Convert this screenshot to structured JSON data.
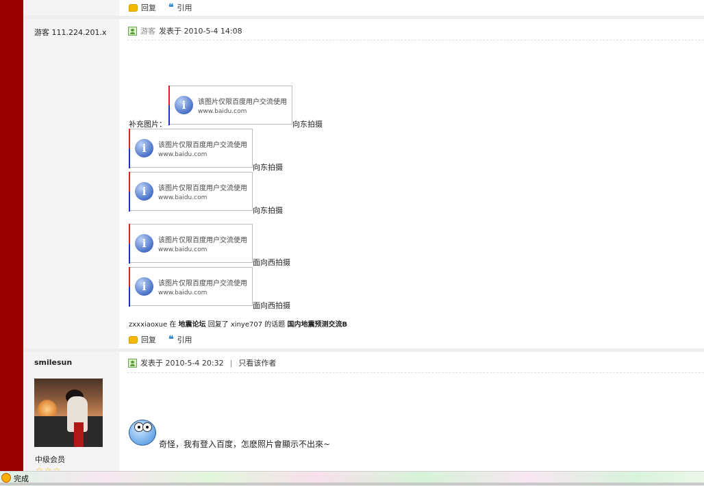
{
  "post_top": {
    "actions": {
      "reply": "回复",
      "quote": "引用"
    }
  },
  "post1": {
    "author": "游客 111.224.201.x",
    "meta": {
      "guest_label": "游客",
      "posted_text": "发表于 2010-5-4 14:08"
    },
    "supplement_label": "补充图片：",
    "image_placeholders": [
      {
        "line1": "该图片仅限百度用户交流使用",
        "line2": "www.baidu.com",
        "caption": "向东拍摄"
      },
      {
        "line1": "该图片仅限百度用户交流使用",
        "line2": "www.baidu.com",
        "caption": "向东拍摄"
      },
      {
        "line1": "该图片仅限百度用户交流使用",
        "line2": "www.baidu.com",
        "caption": "向东拍摄"
      },
      {
        "line1": "该图片仅限百度用户交流使用",
        "line2": "www.baidu.com",
        "caption": "面向西拍摄"
      },
      {
        "line1": "该图片仅限百度用户交流使用",
        "line2": "www.baidu.com",
        "caption": "面向西拍摄"
      }
    ],
    "activity": {
      "user": "zxxxiaoxue",
      "in_word": "在",
      "forum": "地震论坛",
      "replied": "回复了",
      "target_user": "xinye707",
      "topic_word": "的话题",
      "topic": "国内地震预测交流B"
    },
    "actions": {
      "reply": "回复",
      "quote": "引用"
    }
  },
  "post2": {
    "author": "smilesun",
    "rank": "中级会员",
    "stars": "☆☆☆",
    "meta": {
      "posted_text": "发表于 2010-5-4 20:32",
      "divider": "|",
      "only_author": "只看该作者"
    },
    "content": "奇怪，我有登入百度，怎麽照片會顯示不出來~"
  },
  "status_bar": {
    "text": "完成"
  },
  "icons": {
    "reply": "reply-bubble-icon",
    "quote": "quote-marks-icon",
    "guest": "guest-user-icon",
    "info": "info-icon",
    "emoticon": "confused-face-emoticon",
    "browser": "browser-status-icon"
  },
  "colors": {
    "left_bar": "#9b0000",
    "reply_icon": "#f5b800",
    "quote_icon": "#3b8dcf",
    "info_icon": "#4a72c8"
  }
}
